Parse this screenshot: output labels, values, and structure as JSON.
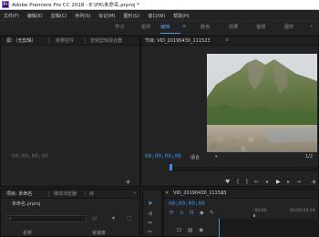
{
  "window": {
    "app_logo": "Pr",
    "title": "Adobe Premiere Pro CC 2018 - E:\\PR\\未命名.prproj *"
  },
  "menu": [
    "文件(F)",
    "编辑(E)",
    "剪辑(C)",
    "序列(S)",
    "标记(M)",
    "图形(G)",
    "窗口(W)",
    "帮助(H)"
  ],
  "workspaces": [
    {
      "label": "学习",
      "active": false
    },
    {
      "label": "组件",
      "active": false
    },
    {
      "label": "编辑",
      "active": true
    },
    {
      "label": "颜色",
      "active": false
    },
    {
      "label": "效果",
      "active": false
    },
    {
      "label": "音频",
      "active": false
    },
    {
      "label": "图形",
      "active": false
    }
  ],
  "workspace_menu_symbol": "≡",
  "workspace_overflow": "»",
  "source_panel": {
    "tabs": [
      "源：（无剪辑）",
      "效果控件",
      "音频剪辑混合器"
    ],
    "menu_symbol": "≡",
    "timecode": "00;00;00;00",
    "add_symbol": "+"
  },
  "program_panel": {
    "title": "节目: VID_20190430_111523",
    "menu_symbol": "≡",
    "timecode": "00;00;00;00",
    "fit_label": "适合",
    "duration": "1/2",
    "add_symbol": "+"
  },
  "project_panel": {
    "tabs": [
      "项目: 未命名",
      "媒体浏览器",
      "库"
    ],
    "overflow": "»",
    "file_name": "未命名.prproj",
    "columns": [
      "名称",
      "帧速率"
    ]
  },
  "timeline_panel": {
    "sequence_name": "VID_20190430_111523",
    "timecode": "00;00;00;00",
    "ruler_start": ":00;00",
    "ruler_mark": "00;00;04;29"
  },
  "colors": {
    "accent_blue": "#3e8fe6",
    "panel_bg": "#232323",
    "window_bg": "#1d1d1d",
    "workspace_active": "#4b9ae6",
    "tab_active_marker": "#cfcfcf"
  }
}
